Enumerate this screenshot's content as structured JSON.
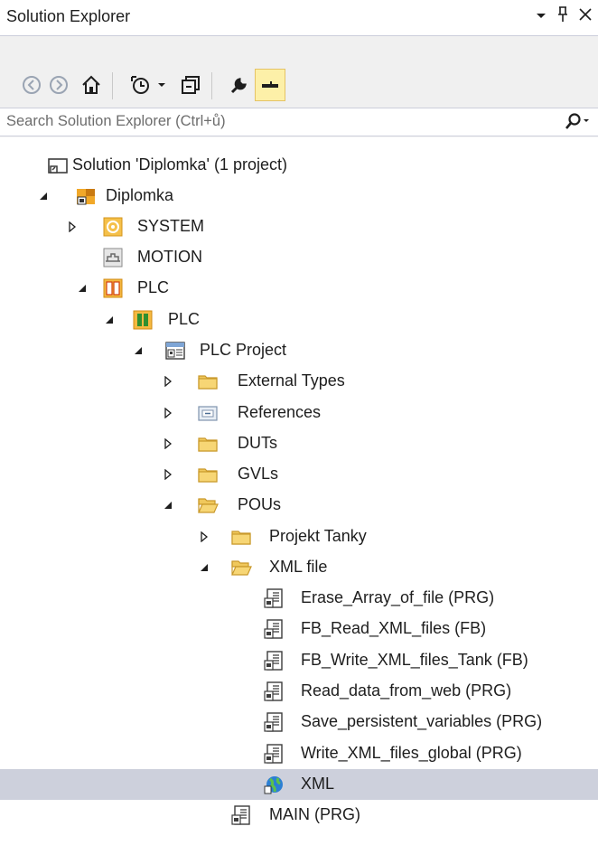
{
  "window": {
    "title": "Solution Explorer",
    "controls": [
      "▾",
      "ᵖ",
      "✕"
    ]
  },
  "search": {
    "placeholder": "Search Solution Explorer (Ctrl+ů)"
  },
  "toolbar": {
    "buttons": [
      "back-icon",
      "forward-icon",
      "home-icon",
      "history-icon",
      "dropdown-icon",
      "collapse-all-icon",
      "properties-icon",
      "preview-icon"
    ]
  },
  "tree": [
    {
      "label": "Solution 'Diplomka' (1 project)",
      "icon": "solution-icon",
      "expand": "none"
    },
    {
      "label": "Diplomka",
      "icon": "twincat-project-icon",
      "expand": "expanded"
    },
    {
      "label": "SYSTEM",
      "icon": "system-icon",
      "expand": "collapsed"
    },
    {
      "label": "MOTION",
      "icon": "motion-icon",
      "expand": "none"
    },
    {
      "label": "PLC",
      "icon": "plc-icon",
      "expand": "expanded"
    },
    {
      "label": "PLC",
      "icon": "plc-instance-icon",
      "expand": "expanded"
    },
    {
      "label": "PLC Project",
      "icon": "plc-project-icon",
      "expand": "expanded"
    },
    {
      "label": "External Types",
      "icon": "folder-icon",
      "expand": "collapsed"
    },
    {
      "label": "References",
      "icon": "references-icon",
      "expand": "collapsed"
    },
    {
      "label": "DUTs",
      "icon": "folder-icon",
      "expand": "collapsed"
    },
    {
      "label": "GVLs",
      "icon": "folder-icon",
      "expand": "collapsed"
    },
    {
      "label": "POUs",
      "icon": "folder-open-icon",
      "expand": "expanded"
    },
    {
      "label": "Projekt Tanky",
      "icon": "folder-icon",
      "expand": "collapsed"
    },
    {
      "label": "XML file",
      "icon": "folder-open-icon",
      "expand": "expanded"
    },
    {
      "label": "Erase_Array_of_file (PRG)",
      "icon": "pou-icon",
      "expand": "none"
    },
    {
      "label": "FB_Read_XML_files (FB)",
      "icon": "pou-icon",
      "expand": "none"
    },
    {
      "label": "FB_Write_XML_files_Tank (FB)",
      "icon": "pou-icon",
      "expand": "none"
    },
    {
      "label": "Read_data_from_web (PRG)",
      "icon": "pou-icon",
      "expand": "none"
    },
    {
      "label": "Save_persistent_variables (PRG)",
      "icon": "pou-icon",
      "expand": "none"
    },
    {
      "label": "Write_XML_files_global (PRG)",
      "icon": "pou-icon",
      "expand": "none"
    },
    {
      "label": "XML",
      "icon": "xml-web-icon",
      "expand": "none",
      "selected": true
    },
    {
      "label": "MAIN (PRG)",
      "icon": "pou-icon",
      "expand": "none"
    }
  ],
  "colors": {
    "selection": "#cdd0dc",
    "folder": "#e8c15a",
    "accent": "#f7d35a"
  }
}
